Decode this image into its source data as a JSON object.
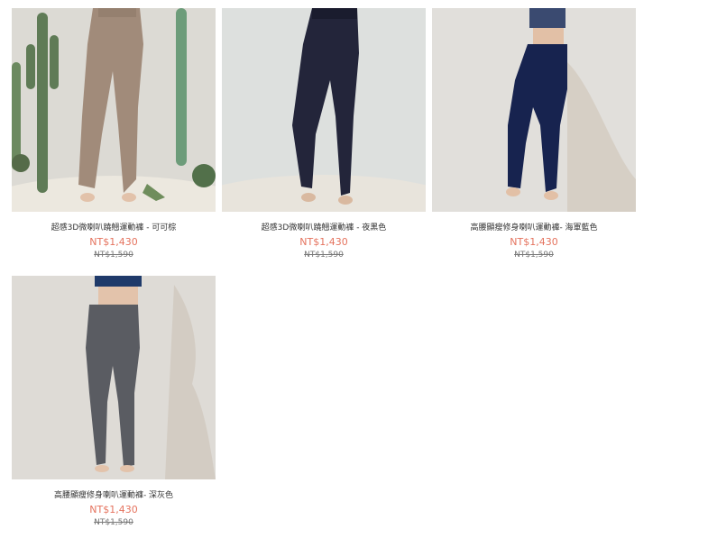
{
  "products": [
    {
      "name": "超感3D微喇叭蹺翹運動褲 - 可可棕",
      "price": "NT$1,430",
      "original_price": "NT$1,590",
      "pants_color": "#a18b7a",
      "bg_color": "#dcdad4"
    },
    {
      "name": "超感3D微喇叭蹺翹運動褲 - 夜黑色",
      "price": "NT$1,430",
      "original_price": "NT$1,590",
      "pants_color": "#23253a",
      "bg_color": "#dde0de"
    },
    {
      "name": "高腰顯瘦修身喇叭運動褲- 海軍藍色",
      "price": "NT$1,430",
      "original_price": "NT$1,590",
      "pants_color": "#17234f",
      "bg_color": "#e1dfdb"
    },
    {
      "name": "高腰顯瘦修身喇叭運動褲- 深灰色",
      "price": "NT$1,430",
      "original_price": "NT$1,590",
      "pants_color": "#5a5c62",
      "bg_color": "#dedbd6"
    }
  ]
}
